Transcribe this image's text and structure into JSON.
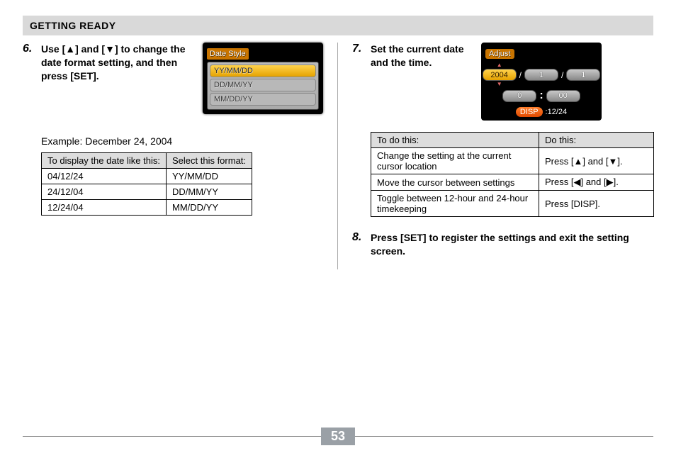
{
  "header": "GETTING READY",
  "step6": {
    "num": "6.",
    "text_parts": [
      "Use [",
      "] and [",
      "] to change the date format setting, and then press [SET]."
    ]
  },
  "example": "Example: December 24, 2004",
  "fmt_table": {
    "head": [
      "To display the date like this:",
      "Select this format:"
    ],
    "rows": [
      [
        "04/12/24",
        "YY/MM/DD"
      ],
      [
        "24/12/04",
        "DD/MM/YY"
      ],
      [
        "12/24/04",
        "MM/DD/YY"
      ]
    ]
  },
  "date_style_lcd": {
    "title": "Date Style",
    "options": [
      "YY/MM/DD",
      "DD/MM/YY",
      "MM/DD/YY"
    ]
  },
  "step7": {
    "num": "7.",
    "text": "Set the current date and the time."
  },
  "adjust_lcd": {
    "title": "Adjust",
    "year": "2004",
    "month": "1",
    "day": "1",
    "hour": "0",
    "minute": "00",
    "disp_label": "DISP",
    "disp_value": ":12/24"
  },
  "action_table": {
    "head": [
      "To do this:",
      "Do this:"
    ],
    "rows": [
      {
        "todo": "Change the setting at the current cursor location",
        "action_prefix": "Press [",
        "action_mid": "] and [",
        "action_suffix": "].",
        "icons": [
          "up",
          "down"
        ]
      },
      {
        "todo": "Move the cursor between settings",
        "action_prefix": "Press [",
        "action_mid": "] and [",
        "action_suffix": "].",
        "icons": [
          "left",
          "right"
        ]
      },
      {
        "todo": "Toggle between 12-hour and 24-hour timekeeping",
        "action_full": "Press [DISP]."
      }
    ]
  },
  "step8": {
    "num": "8.",
    "text": "Press [SET] to register the settings and exit the setting screen."
  },
  "page_number": "53"
}
